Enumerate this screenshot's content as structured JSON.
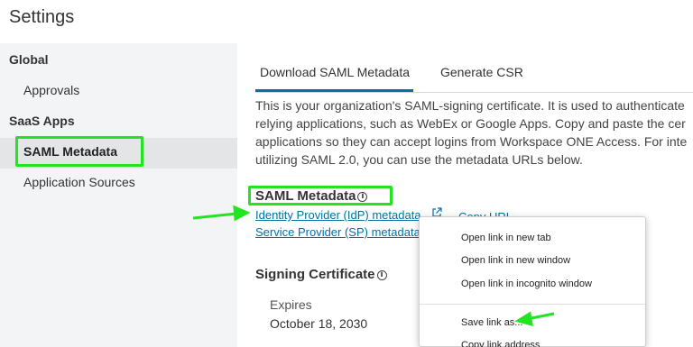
{
  "page": {
    "title": "Settings"
  },
  "sidebar": {
    "groups": [
      {
        "label": "Global",
        "items": [
          {
            "label": "Approvals"
          }
        ]
      },
      {
        "label": "SaaS Apps",
        "items": [
          {
            "label": "SAML Metadata",
            "active": true
          },
          {
            "label": "Application Sources"
          }
        ]
      }
    ]
  },
  "tabs": [
    {
      "label": "Download SAML Metadata",
      "active": true
    },
    {
      "label": "Generate CSR",
      "active": false
    }
  ],
  "description": {
    "lines": [
      "This is your organization's SAML-signing certificate. It is used to authenticate",
      "relying applications, such as WebEx or Google Apps. Copy and paste the cer",
      "applications so they can accept logins from Workspace ONE Access. For inte",
      "utilizing SAML 2.0, you can use the metadata URLs below."
    ]
  },
  "saml_metadata": {
    "title": "SAML Metadata",
    "idp_link": "Identity Provider (IdP) metadata",
    "sp_link": "Service Provider (SP) metadata",
    "copy_url": "Copy URL"
  },
  "signing_certificate": {
    "title": "Signing Certificate",
    "expires_label": "Expires",
    "expires_value": "October 18, 2030"
  },
  "context_menu": {
    "items": [
      "Open link in new tab",
      "Open link in new window",
      "Open link in incognito window",
      "Save link as...",
      "Copy link address"
    ]
  },
  "colors": {
    "highlight": "#22e51f",
    "link": "#0072a3",
    "sidebar_bg": "#f3f4f5"
  },
  "icons": [
    "info-icon",
    "external-link-icon",
    "annotation-arrow"
  ]
}
